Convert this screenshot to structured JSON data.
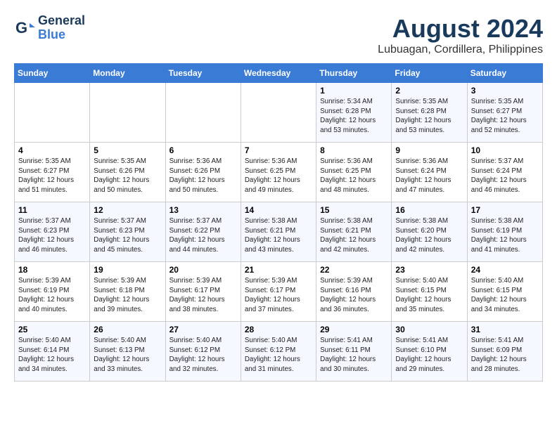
{
  "header": {
    "logo_general": "General",
    "logo_blue": "Blue",
    "month_year": "August 2024",
    "location": "Lubuagan, Cordillera, Philippines"
  },
  "weekdays": [
    "Sunday",
    "Monday",
    "Tuesday",
    "Wednesday",
    "Thursday",
    "Friday",
    "Saturday"
  ],
  "weeks": [
    [
      {
        "day": "",
        "info": ""
      },
      {
        "day": "",
        "info": ""
      },
      {
        "day": "",
        "info": ""
      },
      {
        "day": "",
        "info": ""
      },
      {
        "day": "1",
        "info": "Sunrise: 5:34 AM\nSunset: 6:28 PM\nDaylight: 12 hours\nand 53 minutes."
      },
      {
        "day": "2",
        "info": "Sunrise: 5:35 AM\nSunset: 6:28 PM\nDaylight: 12 hours\nand 53 minutes."
      },
      {
        "day": "3",
        "info": "Sunrise: 5:35 AM\nSunset: 6:27 PM\nDaylight: 12 hours\nand 52 minutes."
      }
    ],
    [
      {
        "day": "4",
        "info": "Sunrise: 5:35 AM\nSunset: 6:27 PM\nDaylight: 12 hours\nand 51 minutes."
      },
      {
        "day": "5",
        "info": "Sunrise: 5:35 AM\nSunset: 6:26 PM\nDaylight: 12 hours\nand 50 minutes."
      },
      {
        "day": "6",
        "info": "Sunrise: 5:36 AM\nSunset: 6:26 PM\nDaylight: 12 hours\nand 50 minutes."
      },
      {
        "day": "7",
        "info": "Sunrise: 5:36 AM\nSunset: 6:25 PM\nDaylight: 12 hours\nand 49 minutes."
      },
      {
        "day": "8",
        "info": "Sunrise: 5:36 AM\nSunset: 6:25 PM\nDaylight: 12 hours\nand 48 minutes."
      },
      {
        "day": "9",
        "info": "Sunrise: 5:36 AM\nSunset: 6:24 PM\nDaylight: 12 hours\nand 47 minutes."
      },
      {
        "day": "10",
        "info": "Sunrise: 5:37 AM\nSunset: 6:24 PM\nDaylight: 12 hours\nand 46 minutes."
      }
    ],
    [
      {
        "day": "11",
        "info": "Sunrise: 5:37 AM\nSunset: 6:23 PM\nDaylight: 12 hours\nand 46 minutes."
      },
      {
        "day": "12",
        "info": "Sunrise: 5:37 AM\nSunset: 6:23 PM\nDaylight: 12 hours\nand 45 minutes."
      },
      {
        "day": "13",
        "info": "Sunrise: 5:37 AM\nSunset: 6:22 PM\nDaylight: 12 hours\nand 44 minutes."
      },
      {
        "day": "14",
        "info": "Sunrise: 5:38 AM\nSunset: 6:21 PM\nDaylight: 12 hours\nand 43 minutes."
      },
      {
        "day": "15",
        "info": "Sunrise: 5:38 AM\nSunset: 6:21 PM\nDaylight: 12 hours\nand 42 minutes."
      },
      {
        "day": "16",
        "info": "Sunrise: 5:38 AM\nSunset: 6:20 PM\nDaylight: 12 hours\nand 42 minutes."
      },
      {
        "day": "17",
        "info": "Sunrise: 5:38 AM\nSunset: 6:19 PM\nDaylight: 12 hours\nand 41 minutes."
      }
    ],
    [
      {
        "day": "18",
        "info": "Sunrise: 5:39 AM\nSunset: 6:19 PM\nDaylight: 12 hours\nand 40 minutes."
      },
      {
        "day": "19",
        "info": "Sunrise: 5:39 AM\nSunset: 6:18 PM\nDaylight: 12 hours\nand 39 minutes."
      },
      {
        "day": "20",
        "info": "Sunrise: 5:39 AM\nSunset: 6:17 PM\nDaylight: 12 hours\nand 38 minutes."
      },
      {
        "day": "21",
        "info": "Sunrise: 5:39 AM\nSunset: 6:17 PM\nDaylight: 12 hours\nand 37 minutes."
      },
      {
        "day": "22",
        "info": "Sunrise: 5:39 AM\nSunset: 6:16 PM\nDaylight: 12 hours\nand 36 minutes."
      },
      {
        "day": "23",
        "info": "Sunrise: 5:40 AM\nSunset: 6:15 PM\nDaylight: 12 hours\nand 35 minutes."
      },
      {
        "day": "24",
        "info": "Sunrise: 5:40 AM\nSunset: 6:15 PM\nDaylight: 12 hours\nand 34 minutes."
      }
    ],
    [
      {
        "day": "25",
        "info": "Sunrise: 5:40 AM\nSunset: 6:14 PM\nDaylight: 12 hours\nand 34 minutes."
      },
      {
        "day": "26",
        "info": "Sunrise: 5:40 AM\nSunset: 6:13 PM\nDaylight: 12 hours\nand 33 minutes."
      },
      {
        "day": "27",
        "info": "Sunrise: 5:40 AM\nSunset: 6:12 PM\nDaylight: 12 hours\nand 32 minutes."
      },
      {
        "day": "28",
        "info": "Sunrise: 5:40 AM\nSunset: 6:12 PM\nDaylight: 12 hours\nand 31 minutes."
      },
      {
        "day": "29",
        "info": "Sunrise: 5:41 AM\nSunset: 6:11 PM\nDaylight: 12 hours\nand 30 minutes."
      },
      {
        "day": "30",
        "info": "Sunrise: 5:41 AM\nSunset: 6:10 PM\nDaylight: 12 hours\nand 29 minutes."
      },
      {
        "day": "31",
        "info": "Sunrise: 5:41 AM\nSunset: 6:09 PM\nDaylight: 12 hours\nand 28 minutes."
      }
    ]
  ]
}
